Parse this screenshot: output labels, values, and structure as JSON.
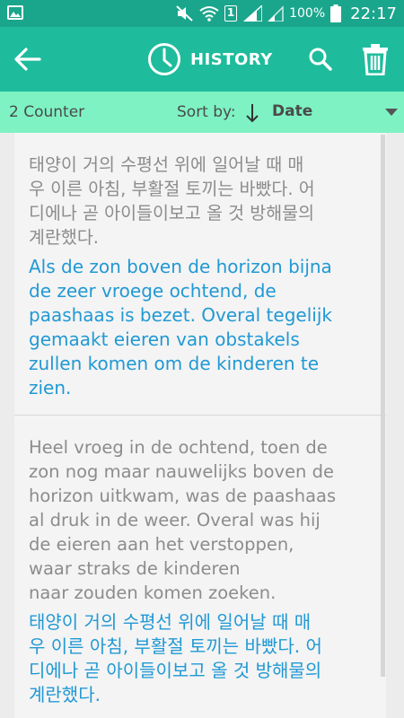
{
  "status_bar": {
    "battery_percent": "100%",
    "time": "22:17",
    "sim_label": "1"
  },
  "app_bar": {
    "title": "HISTORY",
    "icons": [
      "back-arrow-icon",
      "clock-icon",
      "search-icon",
      "trash-icon"
    ]
  },
  "toolbar": {
    "counter": "2 Counter",
    "sort_by_label": "Sort by:",
    "sort_value": "Date"
  },
  "entries": [
    {
      "source": "태양이 거의 수평선 위에 일어날 때 매\n우 이른 아침, 부활절 토끼는 바빴다. 어\n디에나 곧 아이들이보고 올 것 방해물의\n계란했다.",
      "translation": "Als de zon boven de horizon bijna\nde zeer vroege ochtend, de\npaashaas is bezet. Overal tegelijk\ngemaakt eieren van obstakels\nzullen komen om de kinderen te\nzien."
    },
    {
      "source": "Heel vroeg in de ochtend, toen de\nzon nog maar nauwelijks boven de\nhorizon uitkwam, was de paashaas\nal druk in de weer. Overal was hij\nde eieren aan het verstoppen,\nwaar straks de kinderen\nnaar zouden komen zoeken.",
      "translation": "태양이 거의 수평선 위에 일어날 때 매\n우 이른 아침, 부활절 토끼는 바빴다. 어\n디에나 곧 아이들이보고 올 것 방해물의\n계란했다."
    }
  ],
  "colors": {
    "status_bar": "#1aa68c",
    "app_bar": "#1ebc9c",
    "toolbar": "#7ef2c3",
    "source_text": "#8c8c8c",
    "translation_text": "#2199d4"
  }
}
